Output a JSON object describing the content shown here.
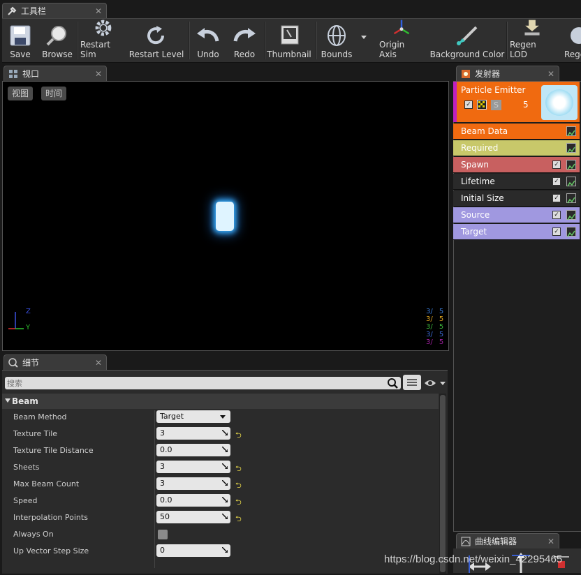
{
  "toolbar_tab": {
    "title": "工具栏"
  },
  "toolbar": {
    "buttons": [
      {
        "label": "Save"
      },
      {
        "label": "Browse"
      },
      {
        "label": "Restart Sim"
      },
      {
        "label": "Restart Level"
      },
      {
        "label": "Undo"
      },
      {
        "label": "Redo"
      },
      {
        "label": "Thumbnail"
      },
      {
        "label": "Bounds"
      },
      {
        "label": "Origin Axis"
      },
      {
        "label": "Background Color"
      },
      {
        "label": "Regen LOD"
      },
      {
        "label": "Rege"
      }
    ]
  },
  "viewport_tab": {
    "title": "视口"
  },
  "viewport": {
    "view_button": "视图",
    "time_button": "时间",
    "stats": [
      {
        "a": "3/",
        "b": "5",
        "color": "#3a7bd5"
      },
      {
        "a": "3/",
        "b": "5",
        "color": "#d8a020"
      },
      {
        "a": "3/",
        "b": "5",
        "color": "#3ab03a"
      },
      {
        "a": "3/",
        "b": "5",
        "color": "#3a6ad5"
      },
      {
        "a": "3/",
        "b": "5",
        "color": "#a020a0"
      }
    ],
    "axis": {
      "z": "Z",
      "y": "Y"
    }
  },
  "details_tab": {
    "title": "细节"
  },
  "details": {
    "search_placeholder": "搜索",
    "section": "Beam",
    "properties": [
      {
        "label": "Beam Method",
        "value": "Target",
        "kind": "dropdown",
        "reset": false
      },
      {
        "label": "Texture Tile",
        "value": "3",
        "kind": "number",
        "reset": true
      },
      {
        "label": "Texture Tile Distance",
        "value": "0.0",
        "kind": "number",
        "reset": false
      },
      {
        "label": "Sheets",
        "value": "3",
        "kind": "number",
        "reset": true
      },
      {
        "label": "Max Beam Count",
        "value": "3",
        "kind": "number",
        "reset": true
      },
      {
        "label": "Speed",
        "value": "0.0",
        "kind": "number",
        "reset": true
      },
      {
        "label": "Interpolation Points",
        "value": "50",
        "kind": "number",
        "reset": true
      },
      {
        "label": "Always On",
        "value": "",
        "kind": "checkbox",
        "reset": false
      },
      {
        "label": "Up Vector Step Size",
        "value": "0",
        "kind": "number",
        "reset": false
      }
    ]
  },
  "emitter_tab": {
    "title": "发射器"
  },
  "emitter": {
    "name": "Particle Emitter",
    "count": "5",
    "s_label": "S",
    "modules": [
      {
        "label": "Beam Data",
        "bg": "#f06a10",
        "checkbox": false
      },
      {
        "label": "Required",
        "bg": "#c8c86a",
        "checkbox": false
      },
      {
        "label": "Spawn",
        "bg": "#c86060",
        "checkbox": true
      },
      {
        "label": "Lifetime",
        "bg": "#2a2a2a",
        "checkbox": true
      },
      {
        "label": "Initial Size",
        "bg": "#2a2a2a",
        "checkbox": true
      },
      {
        "label": "Source",
        "bg": "#a098e0",
        "checkbox": true
      },
      {
        "label": "Target",
        "bg": "#a098e0",
        "checkbox": true
      }
    ]
  },
  "curve_tab": {
    "title": "曲线编辑器"
  },
  "watermark": "https://blog.csdn.net/weixin_42295465"
}
